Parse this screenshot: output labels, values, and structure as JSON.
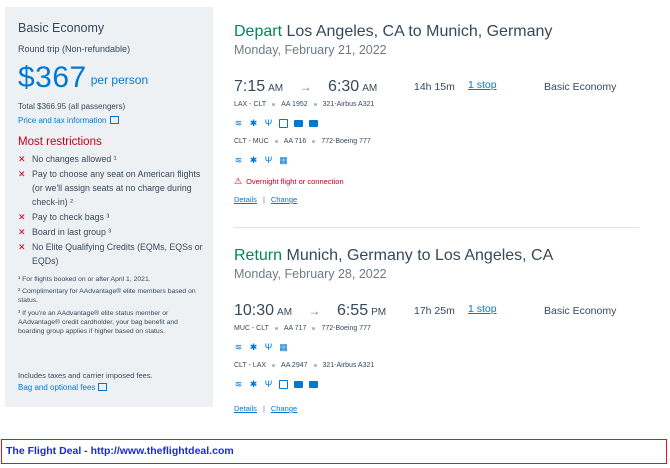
{
  "sidebar": {
    "fare_title": "Basic Economy",
    "fare_sub": "Round trip (Non-refundable)",
    "price": "$367",
    "per_person": "per person",
    "total": "Total $366.95 (all passengers)",
    "price_tax_link": "Price and tax information",
    "restrictions_title": "Most restrictions",
    "restrictions": [
      "No changes allowed ¹",
      "Pay to choose any seat on American flights (or we'll assign seats at no charge during check-in) ²",
      "Pay to check bags ³",
      "Board in last group ³",
      "No Elite Qualifying Credits (EQMs, EQSs or EQDs)"
    ],
    "notes": [
      "¹ For flights booked on or after April 1, 2021.",
      "² Complimentary for AAdvantage® elite members based on status.",
      "³ If you're an AAdvantage® elite status member or AAdvantage® credit cardholder, your bag benefit and boarding group applies if higher based on status."
    ],
    "taxes_note": "Includes taxes and carrier imposed fees.",
    "bag_fees_link": "Bag and optional fees"
  },
  "depart": {
    "keyword": "Depart",
    "route": "Los Angeles, CA to Munich, Germany",
    "date": "Monday, February 21, 2022",
    "dep_time": "7:15",
    "dep_ampm": "AM",
    "arrow": "→",
    "arr_time": "6:30",
    "arr_ampm": "AM",
    "duration": "14h 15m",
    "stops": "1 stop",
    "cabin": "Basic Economy",
    "seg1_route": "LAX - CLT",
    "seg1_flight": "AA 1952",
    "seg1_aircraft": "321-Airbus A321",
    "seg2_route": "CLT - MUC",
    "seg2_flight": "AA 716",
    "seg2_aircraft": "772-Boeing 777",
    "warning": "Overnight flight or connection",
    "details": "Details",
    "change": "Change"
  },
  "return": {
    "keyword": "Return",
    "route": "Munich, Germany to Los Angeles, CA",
    "date": "Monday, February 28, 2022",
    "dep_time": "10:30",
    "dep_ampm": "AM",
    "arrow": "→",
    "arr_time": "6:55",
    "arr_ampm": "PM",
    "duration": "17h 25m",
    "stops": "1 stop",
    "cabin": "Basic Economy",
    "seg1_route": "MUC - CLT",
    "seg1_flight": "AA 717",
    "seg1_aircraft": "772-Boeing 777",
    "seg2_route": "CLT - LAX",
    "seg2_flight": "AA 2947",
    "seg2_aircraft": "321-Airbus A321",
    "details": "Details",
    "change": "Change"
  },
  "footer_banner": "The Flight Deal - http://www.theflightdeal.com",
  "colors": {
    "accent": "#0078d2",
    "green": "#00865e",
    "red": "#c30019",
    "banner_text": "#1a2ad8"
  },
  "icons": [
    "wifi-icon",
    "power-icon",
    "usb-icon",
    "phone-icon",
    "entertainment-icon",
    "app-icon",
    "meal-icon"
  ]
}
